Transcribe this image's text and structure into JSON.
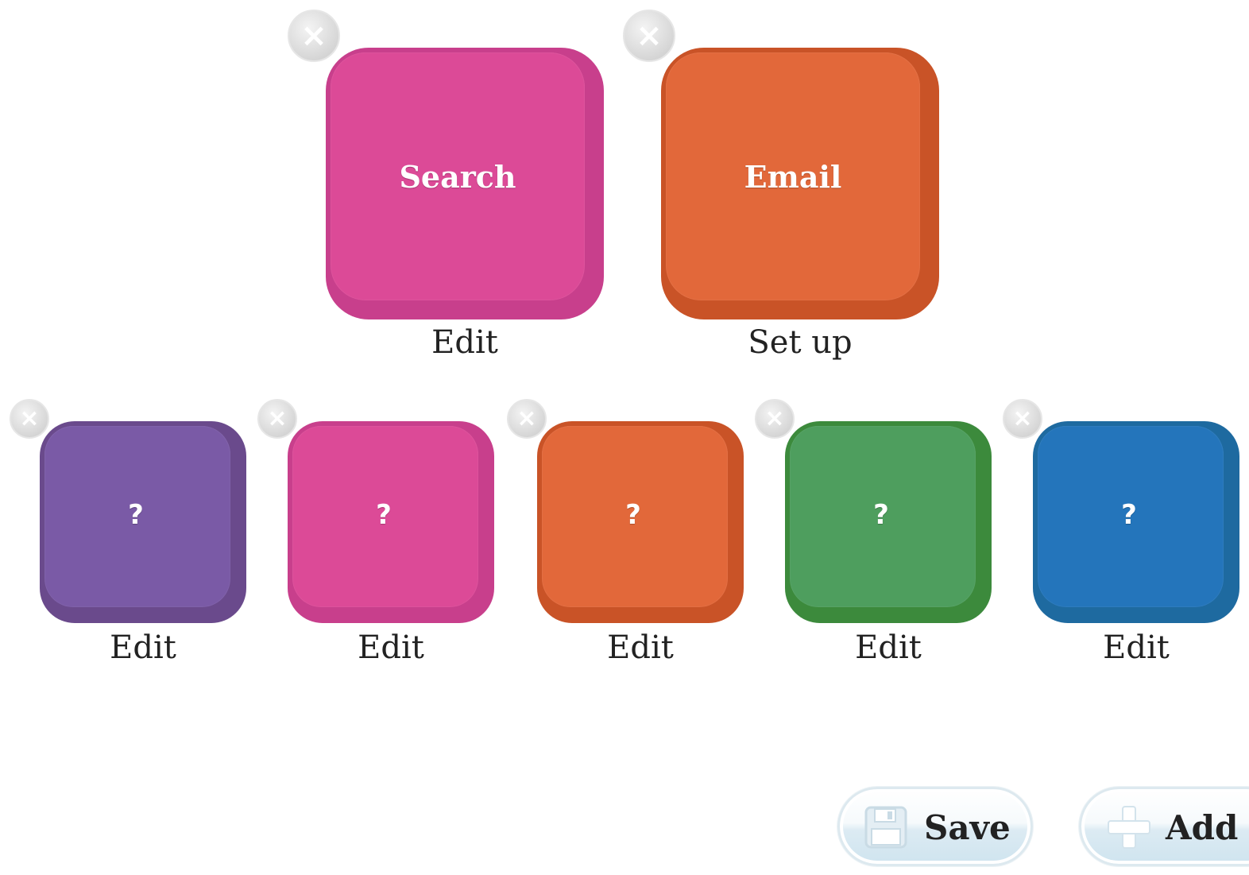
{
  "tiles_top": [
    {
      "label": "Search",
      "caption": "Edit",
      "color": "pink"
    },
    {
      "label": "Email",
      "caption": "Set up",
      "color": "orange"
    }
  ],
  "tiles_bottom": [
    {
      "label": "?",
      "caption": "Edit",
      "color": "purple"
    },
    {
      "label": "?",
      "caption": "Edit",
      "color": "pink"
    },
    {
      "label": "?",
      "caption": "Edit",
      "color": "orange"
    },
    {
      "label": "?",
      "caption": "Edit",
      "color": "green"
    },
    {
      "label": "?",
      "caption": "Edit",
      "color": "blue"
    }
  ],
  "remove_glyph": "×",
  "buttons": {
    "save_label": "Save",
    "save_icon": "floppy-disk-icon",
    "add_label": "Add a",
    "add_icon": "plus-icon"
  },
  "colors": {
    "pink": "#dc4a97",
    "orange": "#e2683a",
    "purple": "#7a5aa6",
    "green": "#4e9e5e",
    "blue": "#2475bb"
  }
}
